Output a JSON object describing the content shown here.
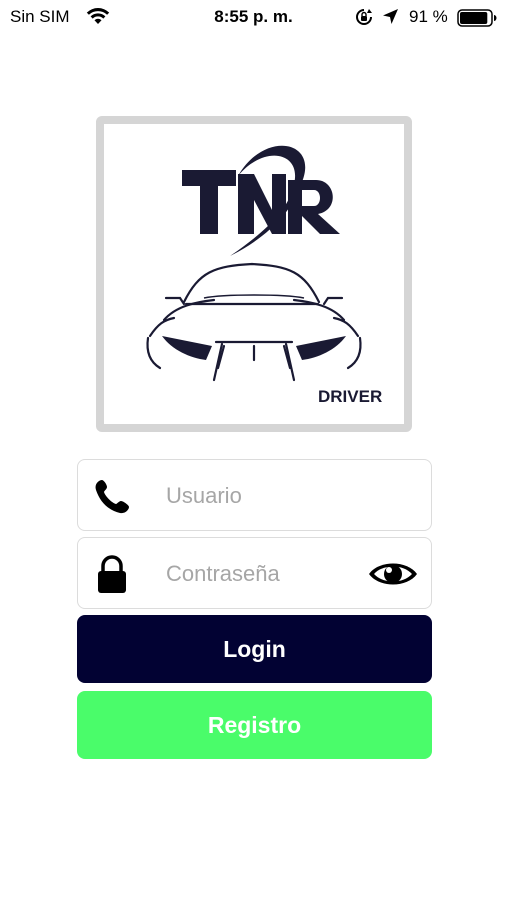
{
  "status_bar": {
    "carrier": "Sin SIM",
    "time": "8:55 p. m.",
    "battery_percent": "91 %",
    "battery_level": 0.91,
    "icons": [
      "wifi-icon",
      "rotation-lock-icon",
      "location-arrow-icon",
      "battery-icon"
    ]
  },
  "logo": {
    "brand": "TNR",
    "tag": "DRIVER",
    "color": "#1a1a33"
  },
  "form": {
    "username": {
      "placeholder": "Usuario",
      "value": "",
      "icon": "phone-icon"
    },
    "password": {
      "placeholder": "Contraseña",
      "value": "",
      "icon": "lock-icon",
      "toggle_icon": "eye-icon"
    }
  },
  "buttons": {
    "login_label": "Login",
    "register_label": "Registro"
  },
  "colors": {
    "login_bg": "#020233",
    "register_bg": "#4afc6a",
    "text_on_button": "#ffffff"
  }
}
